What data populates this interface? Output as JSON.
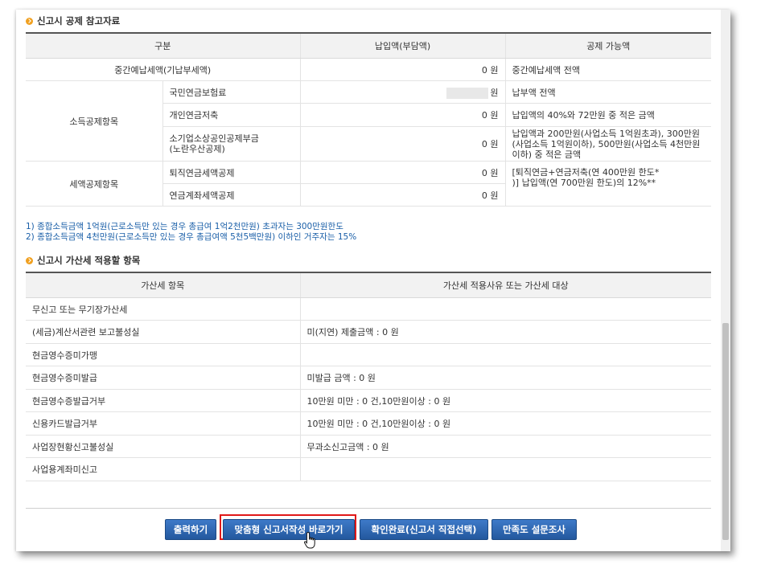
{
  "deduction_section": {
    "title": "신고시 공제 참고자료",
    "headers": [
      "구분",
      "납입액(부담액)",
      "공제 가능액"
    ],
    "interim_row": {
      "label": "중간예납세액(기납부세액)",
      "amount": "0 원",
      "deductible": "중간예납세액 전액"
    },
    "income_group": {
      "label": "소득공제항목",
      "rows": [
        {
          "item": "국민연금보험료",
          "amount": "원",
          "deductible": "납부액 전액"
        },
        {
          "item": "개인연금저축",
          "amount": "0 원",
          "deductible": "납입액의 40%와 72만원 중 적은 금액"
        },
        {
          "item_line1": "소기업소상공인공제부금",
          "item_line2": "(노란우산공제)",
          "amount": "0 원",
          "deductible_lines": [
            "납입액과 200만원(사업소득 1억원초과), 300만원",
            "(사업소득 1억원이하), 500만원(사업소득 4천만원",
            "이하) 중 적은 금액"
          ]
        }
      ]
    },
    "tax_group": {
      "label": "세액공제항목",
      "rows": [
        {
          "item": "퇴직연금세액공제",
          "amount": "0 원"
        },
        {
          "item": "연금계좌세액공제",
          "amount": "0 원"
        }
      ],
      "deductible_lines": [
        "[퇴직연금+연금저축(연 400만원 한도*",
        ")] 납입액(연 700만원 한도)의 12%**"
      ]
    },
    "notes": [
      "1)   종합소득금액 1억원(근로소득만 있는 경우 총급여 1억2천만원) 초과자는 300만원한도",
      "2)   종합소득금액 4천만원(근로소득만 있는 경우 총급여액 5천5백만원) 이하인 거주자는 15%"
    ]
  },
  "penalty_section": {
    "title": "신고시 가산세 적용할 항목",
    "headers": [
      "가산세 항목",
      "가산세 적용사유 또는 가산세 대상"
    ],
    "rows": [
      {
        "item": "무신고 또는 무기장가산세",
        "detail": ""
      },
      {
        "item": "(세금)계산서관련 보고불성실",
        "detail": "미(지연) 제출금액 : 0 원"
      },
      {
        "item": "현금영수증미가맹",
        "detail": ""
      },
      {
        "item": "현금영수증미발급",
        "detail": "미발급 금액 : 0 원"
      },
      {
        "item": "현금영수증발급거부",
        "detail": "10만원 미만 : 0 건,10만원이상 : 0 원"
      },
      {
        "item": "신용카드발급거부",
        "detail": "10만원 미만 : 0 건,10만원이상 : 0 원"
      },
      {
        "item": "사업장현황신고불성실",
        "detail": "무과소신고금액 : 0 원"
      },
      {
        "item": "사업용계좌미신고",
        "detail": ""
      }
    ]
  },
  "buttons": {
    "print": "출력하기",
    "custom_form": "맞춤형 신고서작성 바로가기",
    "confirm": "확인완료(신고서 직접선택)",
    "survey": "만족도 설문조사"
  },
  "colors": {
    "button_blue": "#2f67b1",
    "highlight_red": "#e01818",
    "note_blue": "#1a5fa8",
    "section_icon": "#f0a020"
  }
}
